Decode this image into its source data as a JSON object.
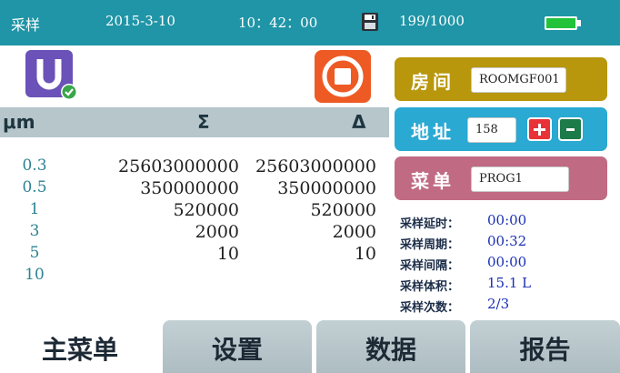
{
  "header": {
    "title": "采样",
    "date": "2015-3-10",
    "time": "10：42：00",
    "sample_count": "199/1000",
    "disk_icon": "save-disk-icon",
    "battery_icon": "battery-icon",
    "battery_level": 1.0
  },
  "table": {
    "headers": {
      "size": "μm",
      "sum": "Σ",
      "delta": "Δ"
    },
    "rows": [
      {
        "size": "0.3",
        "sum": "25603000000",
        "delta": "25603000000"
      },
      {
        "size": "0.5",
        "sum": "350000000",
        "delta": "350000000"
      },
      {
        "size": "1",
        "sum": "520000",
        "delta": "520000"
      },
      {
        "size": "3",
        "sum": "2000",
        "delta": "2000"
      },
      {
        "size": "5",
        "sum": "10",
        "delta": "10"
      },
      {
        "size": "10",
        "sum": "",
        "delta": ""
      }
    ]
  },
  "icons": {
    "usb": "usb-drive-icon",
    "stop": "stop-icon"
  },
  "right_panel": {
    "room": {
      "label": "房间",
      "value": "ROOMGF001"
    },
    "address": {
      "label": "地址",
      "value": "158",
      "plus": "+",
      "minus": "-"
    },
    "menu": {
      "label": "菜单",
      "value": "PROG1"
    },
    "status": [
      {
        "label": "采样延时：",
        "value": "00:00"
      },
      {
        "label": "采样周期：",
        "value": "00:32"
      },
      {
        "label": "采样间隔：",
        "value": "00:00"
      },
      {
        "label": "采样体积：",
        "value": "15.1 L"
      },
      {
        "label": "采样次数：",
        "value": "2/3"
      }
    ]
  },
  "tabs": [
    {
      "label": "主菜单"
    },
    {
      "label": "设置"
    },
    {
      "label": "数据"
    },
    {
      "label": "报告"
    }
  ],
  "colors": {
    "header_bg": "#1f95a7",
    "room_bg": "#b8970c",
    "address_bg": "#2aa9d3",
    "menu_bg": "#c06a84",
    "value_blue": "#1a2fb4"
  }
}
